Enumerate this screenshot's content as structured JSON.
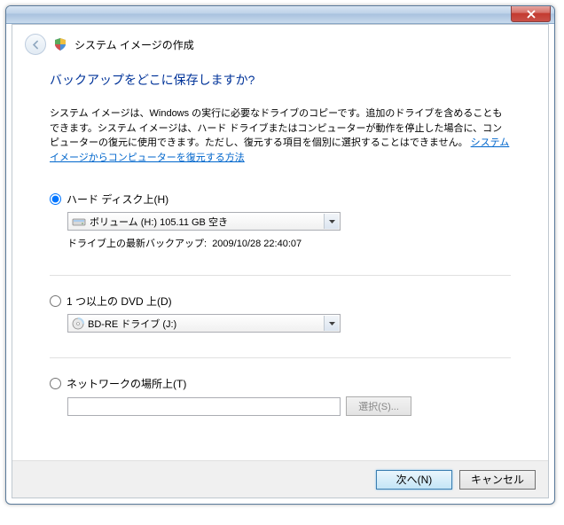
{
  "window": {
    "title": "システム イメージの作成"
  },
  "main": {
    "question": "バックアップをどこに保存しますか?",
    "description_part1": "システム イメージは、Windows の実行に必要なドライブのコピーです。追加のドライブを含めることもできます。システム イメージは、ハード ドライブまたはコンピューターが動作を停止した場合に、コンピューターの復元に使用できます。ただし、復元する項目を個別に選択することはできません。",
    "description_link": "システム イメージからコンピューターを復元する方法"
  },
  "options": {
    "hard_disk": {
      "label": "ハード ディスク上(H)",
      "selected_value": "ボリューム (H:)  105.11 GB 空き",
      "info_label": "ドライブ上の最新バックアップ:",
      "info_value": "2009/10/28 22:40:07"
    },
    "dvd": {
      "label": "1 つ以上の DVD 上(D)",
      "selected_value": "BD-RE ドライブ (J:)"
    },
    "network": {
      "label": "ネットワークの場所上(T)",
      "value": "",
      "browse_label": "選択(S)..."
    }
  },
  "footer": {
    "next": "次へ(N)",
    "cancel": "キャンセル"
  }
}
